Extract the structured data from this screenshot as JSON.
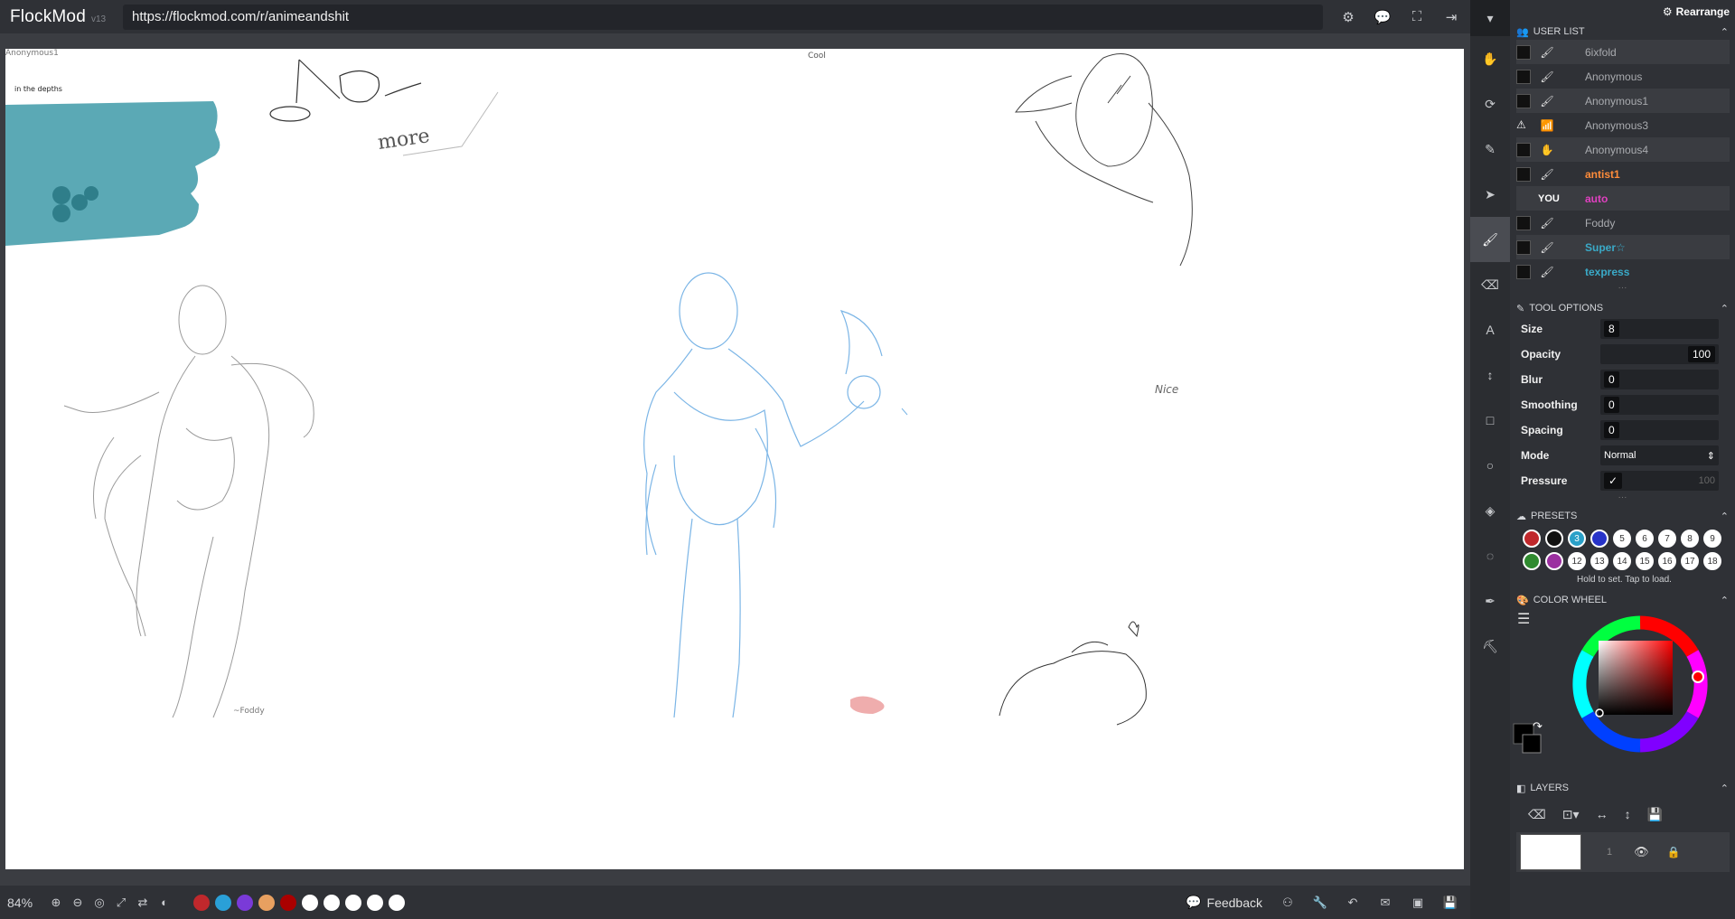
{
  "app": {
    "name": "FlockMod",
    "version": "v13"
  },
  "url": "https://flockmod.com/r/animeandshit",
  "canvas": {
    "labels": {
      "anon1": "Anonymous1",
      "depths": "in the depths",
      "cool": "Cool",
      "more": "more",
      "nice": "Nice",
      "foddy": "~Foddy"
    }
  },
  "panel": {
    "rearrange": "Rearrange",
    "user_list_title": "USER LIST",
    "users": [
      {
        "name": "6ixfold",
        "icon": "brush",
        "color": "#a9abaf"
      },
      {
        "name": "Anonymous",
        "icon": "brush",
        "color": "#a9abaf"
      },
      {
        "name": "Anonymous1",
        "icon": "brush",
        "color": "#a9abaf"
      },
      {
        "name": "Anonymous3",
        "icon": "wifi",
        "color": "#a9abaf"
      },
      {
        "name": "Anonymous4",
        "icon": "hand",
        "color": "#a9abaf"
      },
      {
        "name": "antist1",
        "icon": "brush",
        "color": "#ff8c3a"
      },
      {
        "name": "auto",
        "icon": "you",
        "color": "#e040c0"
      },
      {
        "name": "Foddy",
        "icon": "brush",
        "color": "#a9abaf"
      },
      {
        "name": "Super☆",
        "icon": "brush",
        "color": "#3aaac8"
      },
      {
        "name": "texpress",
        "icon": "brush",
        "color": "#3aaac8"
      }
    ],
    "you_label": "YOU",
    "tool_options_title": "TOOL OPTIONS",
    "options": {
      "size_label": "Size",
      "size": "8",
      "opacity_label": "Opacity",
      "opacity": "100",
      "blur_label": "Blur",
      "blur": "0",
      "smoothing_label": "Smoothing",
      "smoothing": "0",
      "spacing_label": "Spacing",
      "spacing": "0",
      "mode_label": "Mode",
      "mode": "Normal",
      "pressure_label": "Pressure",
      "pressure_value": "100"
    },
    "presets_title": "PRESETS",
    "presets_row1": [
      "",
      "",
      "3",
      "",
      "5",
      "6",
      "7",
      "8",
      "9"
    ],
    "presets_row2": [
      "",
      "",
      "12",
      "13",
      "14",
      "15",
      "16",
      "17",
      "18"
    ],
    "presets_colors1": [
      "#c0282c",
      "#111111",
      "#2aa0c8",
      "#2733c8",
      "#ffffff",
      "#ffffff",
      "#ffffff",
      "#ffffff",
      "#ffffff"
    ],
    "presets_colors2": [
      "#2f8a2f",
      "#9b2fa0",
      "#ffffff",
      "#ffffff",
      "#ffffff",
      "#ffffff",
      "#ffffff",
      "#ffffff",
      "#ffffff"
    ],
    "presets_hint": "Hold to set. Tap to load.",
    "color_wheel_title": "COLOR WHEEL",
    "layers_title": "LAYERS",
    "layer_number": "1"
  },
  "bottom": {
    "zoom": "84%",
    "swatches": [
      "#c0282c",
      "#2aa0d8",
      "#7a3ad8",
      "#e8a060",
      "#aa0000",
      "#ffffff",
      "#ffffff",
      "#ffffff",
      "#ffffff",
      "#ffffff"
    ],
    "feedback": "Feedback"
  }
}
